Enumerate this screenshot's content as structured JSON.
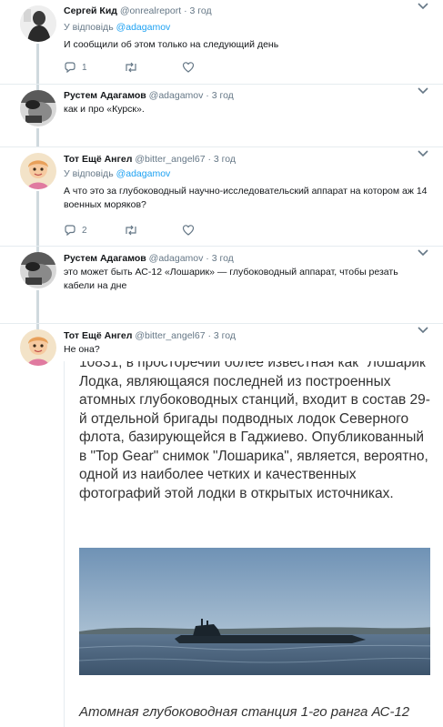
{
  "tweets": [
    {
      "name": "Сергей Кид",
      "handle": "@onrealreport",
      "dot": "·",
      "time": "3 год",
      "reply_prefix": "У відповідь",
      "reply_mention": "@adagamov",
      "text": "И сообщили об этом только на следующий день",
      "reply_count": "1",
      "like_count": ""
    },
    {
      "name": "Рустем Адагамов",
      "handle": "@adagamov",
      "dot": "·",
      "time": "3 год",
      "text": "как и про «Курск»."
    },
    {
      "name": "Тот Ещё Ангел",
      "handle": "@bitter_angel67",
      "dot": "·",
      "time": "3 год",
      "reply_prefix": "У відповідь",
      "reply_mention": "@adagamov",
      "text": "А что это за глубоководный научно-исследовательский аппарат на котором аж 14 военных моряков?",
      "reply_count": "2"
    },
    {
      "name": "Рустем Адагамов",
      "handle": "@adagamov",
      "dot": "·",
      "time": "3 год",
      "text": "это может быть АС-12 «Лошарик» — глубоководный аппарат, чтобы резать кабели на дне"
    },
    {
      "name": "Тот Ещё Ангел",
      "handle": "@bitter_angel67",
      "dot": "·",
      "time": "3 год",
      "text": "Не она?"
    }
  ],
  "attached": {
    "article_text": "10831, в просторечии более известная как \"Лошарик\" Лодка, являющаяся последней из построенных атомных глубоководных станций, входит в состав 29-й отдельной бригады подводных лодок Северного флота, базирующейся в Гаджиево. Опубликованный в \"Top Gear\" снимок \"Лошарика\", является, вероятно, одной из наиболее четких и качественных фотографий этой лодки в открытых источниках.",
    "caption": "Атомная глубоководная станция 1-го ранга АС-12"
  },
  "colors": {
    "link": "#1da1f2",
    "muted": "#657786",
    "thread_line": "#cfd9de",
    "separator": "#e6ecf0"
  },
  "icons": [
    "reply-icon",
    "retweet-icon",
    "like-icon",
    "chevron-down-icon"
  ]
}
